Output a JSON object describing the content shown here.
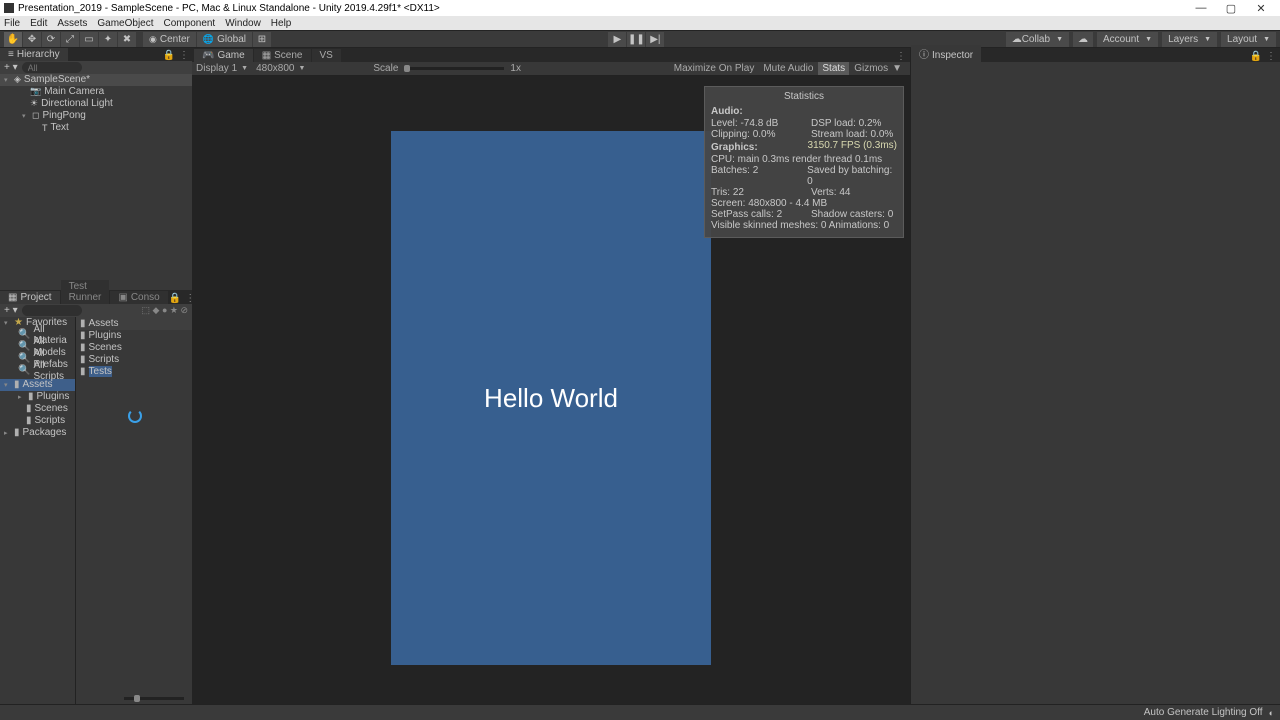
{
  "window": {
    "title": "Presentation_2019 - SampleScene - PC, Mac & Linux Standalone - Unity 2019.4.29f1* <DX11>"
  },
  "menu": [
    "File",
    "Edit",
    "Assets",
    "GameObject",
    "Component",
    "Window",
    "Help"
  ],
  "toolbar": {
    "pivot": "Center",
    "handle": "Global",
    "collab": "Collab",
    "account": "Account",
    "layers": "Layers",
    "layout": "Layout"
  },
  "hierarchy": {
    "tab": "Hierarchy",
    "search_placeholder": "All",
    "scene": "SampleScene*",
    "items": [
      "Main Camera",
      "Directional Light",
      "PingPong",
      "Text"
    ]
  },
  "center": {
    "tabs": {
      "game": "Game",
      "scene": "Scene",
      "vs": "VS"
    },
    "display": "Display 1",
    "aspect": "480x800",
    "scale_label": "Scale",
    "scale_value": "1x",
    "max_on_play": "Maximize On Play",
    "mute": "Mute Audio",
    "stats": "Stats",
    "gizmos": "Gizmos",
    "canvas_text": "Hello World"
  },
  "stats": {
    "title": "Statistics",
    "audio_hdr": "Audio:",
    "level": "Level: -74.8 dB",
    "dsp": "DSP load: 0.2%",
    "clip": "Clipping: 0.0%",
    "stream": "Stream load: 0.0%",
    "gfx_hdr": "Graphics:",
    "fps": "3150.7 FPS (0.3ms)",
    "cpu": "CPU: main 0.3ms  render thread 0.1ms",
    "batches": "Batches: 2",
    "saved": "Saved by batching: 0",
    "tris": "Tris: 22",
    "verts": "Verts: 44",
    "screen": "Screen: 480x800 - 4.4 MB",
    "setpass": "SetPass calls: 2",
    "shadow": "Shadow casters: 0",
    "skinned": "Visible skinned meshes: 0  Animations: 0"
  },
  "project": {
    "tab_project": "Project",
    "tab_runner": "Test Runner",
    "tab_console": "Conso",
    "favorites": "Favorites",
    "fav_items": [
      "All Materia",
      "All Models",
      "All Prefabs",
      "All Scripts"
    ],
    "assets": "Assets",
    "asset_items": [
      "Plugins",
      "Scenes",
      "Scripts"
    ],
    "packages": "Packages",
    "breadcrumb": "Assets",
    "folders": [
      "Plugins",
      "Scenes",
      "Scripts",
      "Tests"
    ]
  },
  "inspector": {
    "tab": "Inspector"
  },
  "statusbar": {
    "lighting": "Auto Generate Lighting Off"
  }
}
